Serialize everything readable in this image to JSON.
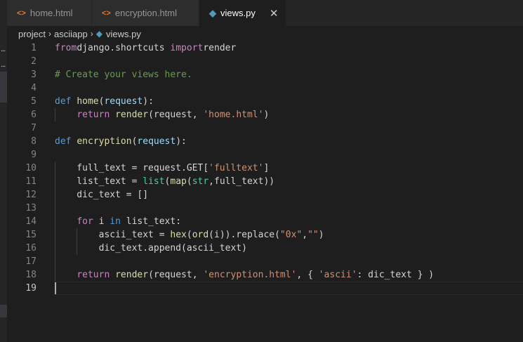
{
  "tabs": [
    {
      "label": "home.html",
      "icon": "html-file-icon",
      "active": false
    },
    {
      "label": "encryption.html",
      "icon": "html-file-icon",
      "active": false
    },
    {
      "label": "views.py",
      "icon": "python-file-icon",
      "active": true
    }
  ],
  "icons": {
    "html": "<>",
    "python": "◆",
    "close": "✕",
    "chevron": "›"
  },
  "breadcrumb": [
    "project",
    "asciiapp",
    "views.py"
  ],
  "colors": {
    "editor_bg": "#1e1e1e",
    "tab_inactive_bg": "#2d2d2d",
    "keyword": "#569cd6",
    "control": "#c586c0",
    "function": "#dcdcaa",
    "string": "#ce9178",
    "comment": "#6a9955",
    "param": "#9cdcfe",
    "builtin": "#4ec9b0"
  },
  "editor": {
    "current_line": 19,
    "lines": [
      {
        "n": "1",
        "t": [
          [
            "kc",
            "from"
          ],
          [
            "",
            "django.shortcuts "
          ],
          [
            "kc",
            "import"
          ],
          [
            "",
            "render"
          ]
        ]
      },
      {
        "n": "2",
        "t": []
      },
      {
        "n": "3",
        "t": [
          [
            "cm",
            "# Create your views here."
          ]
        ]
      },
      {
        "n": "4",
        "t": []
      },
      {
        "n": "5",
        "t": [
          [
            "kw",
            "def "
          ],
          [
            "fn",
            "home"
          ],
          [
            "",
            "("
          ],
          [
            "pa",
            "request"
          ],
          [
            "",
            "):"
          ]
        ]
      },
      {
        "n": "6",
        "t": [
          [
            "",
            "    "
          ],
          [
            "kc",
            "return "
          ],
          [
            "fn",
            "render"
          ],
          [
            "",
            "(request, "
          ],
          [
            "st",
            "'home.html'"
          ],
          [
            "",
            ")"
          ]
        ]
      },
      {
        "n": "7",
        "t": []
      },
      {
        "n": "8",
        "t": [
          [
            "kw",
            "def "
          ],
          [
            "fn",
            "encryption"
          ],
          [
            "",
            "("
          ],
          [
            "pa",
            "request"
          ],
          [
            "",
            "):"
          ]
        ]
      },
      {
        "n": "9",
        "t": []
      },
      {
        "n": "10",
        "t": [
          [
            "",
            "    full_text = request.GET["
          ],
          [
            "st",
            "'fulltext'"
          ],
          [
            "",
            "]"
          ]
        ]
      },
      {
        "n": "11",
        "t": [
          [
            "",
            "    list_text = "
          ],
          [
            "bi",
            "list"
          ],
          [
            "",
            "("
          ],
          [
            "fn",
            "map"
          ],
          [
            "",
            "("
          ],
          [
            "bi",
            "str"
          ],
          [
            "",
            ",full_text))"
          ]
        ]
      },
      {
        "n": "12",
        "t": [
          [
            "",
            "    dic_text = []"
          ]
        ]
      },
      {
        "n": "13",
        "t": []
      },
      {
        "n": "14",
        "t": [
          [
            "",
            "    "
          ],
          [
            "kc",
            "for "
          ],
          [
            "",
            "i "
          ],
          [
            "kw",
            "in "
          ],
          [
            "",
            "list_text:"
          ]
        ]
      },
      {
        "n": "15",
        "t": [
          [
            "",
            "        ascii_text = "
          ],
          [
            "fn",
            "hex"
          ],
          [
            "",
            "("
          ],
          [
            "fn",
            "ord"
          ],
          [
            "",
            "(i)).replace("
          ],
          [
            "st",
            "\"0x\""
          ],
          [
            "",
            ","
          ],
          [
            "st",
            "\"\""
          ],
          [
            "",
            ")"
          ]
        ]
      },
      {
        "n": "16",
        "t": [
          [
            "",
            "        dic_text.append(ascii_text)"
          ]
        ]
      },
      {
        "n": "17",
        "t": []
      },
      {
        "n": "18",
        "t": [
          [
            "",
            "    "
          ],
          [
            "kc",
            "return "
          ],
          [
            "fn",
            "render"
          ],
          [
            "",
            "(request, "
          ],
          [
            "st",
            "'encryption.html'"
          ],
          [
            "",
            ", { "
          ],
          [
            "st",
            "'ascii'"
          ],
          [
            "",
            ": dic_text } )"
          ]
        ]
      },
      {
        "n": "19",
        "t": []
      }
    ]
  }
}
